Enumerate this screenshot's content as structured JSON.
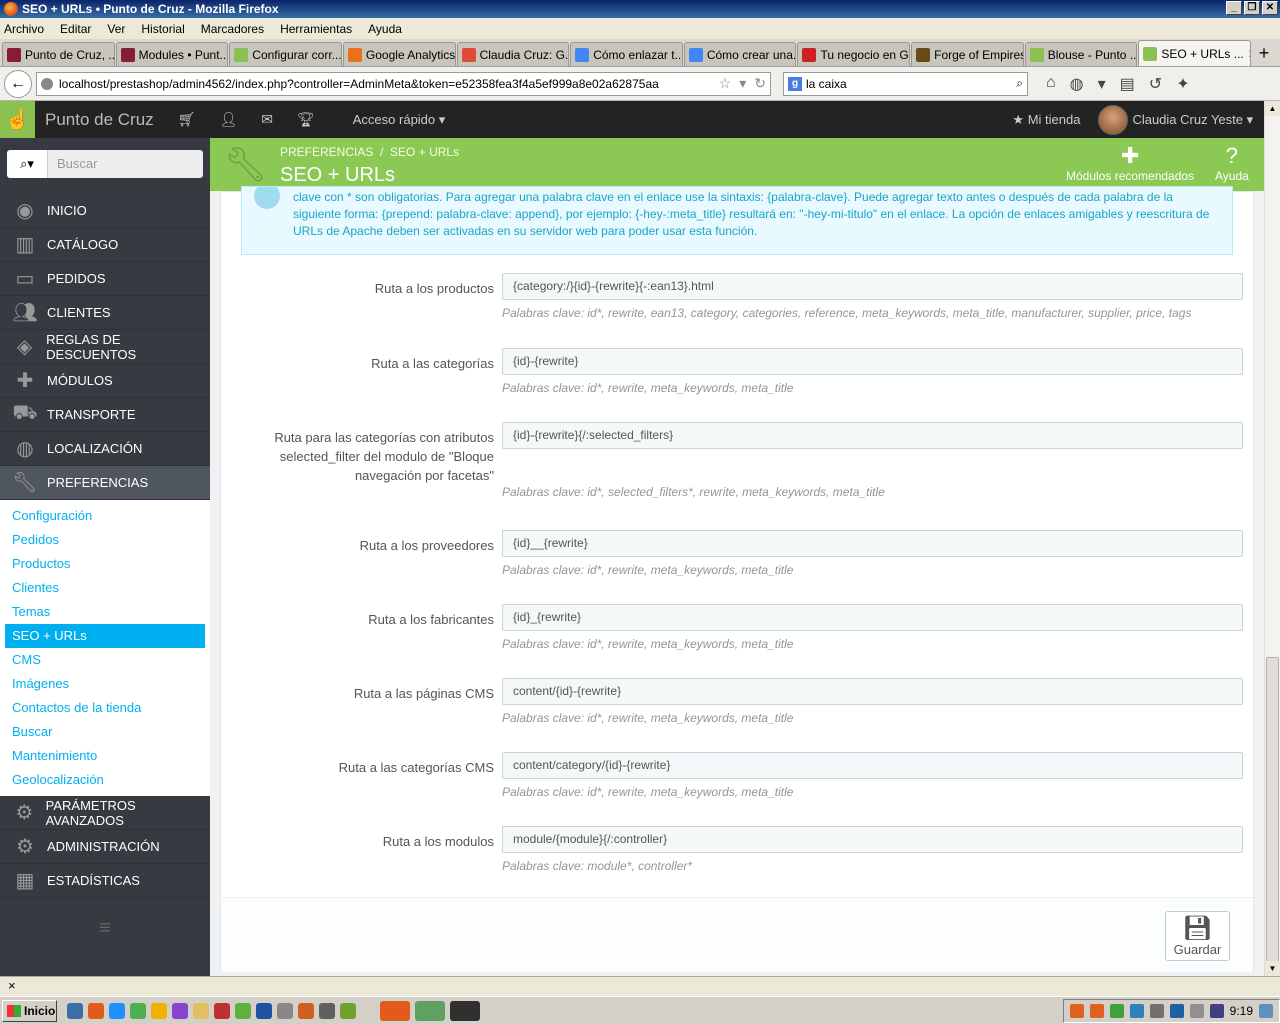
{
  "window": {
    "title": "SEO + URLs • Punto de Cruz - Mozilla Firefox"
  },
  "menubar": [
    "Archivo",
    "Editar",
    "Ver",
    "Historial",
    "Marcadores",
    "Herramientas",
    "Ayuda"
  ],
  "tabs": [
    {
      "label": "Punto de Cruz, ...",
      "color": "#8a1a3a",
      "active": false
    },
    {
      "label": "Modules • Punt...",
      "color": "#8a1a3a",
      "active": false
    },
    {
      "label": "Configurar corr...",
      "color": "#8cc152",
      "active": false
    },
    {
      "label": "Google Analytics",
      "color": "#e8711a",
      "active": false
    },
    {
      "label": "Claudia Cruz: G...",
      "color": "#dd4b39",
      "active": false
    },
    {
      "label": "Cómo enlazar t...",
      "color": "#4285f4",
      "active": false
    },
    {
      "label": "Cómo crear una...",
      "color": "#4285f4",
      "active": false
    },
    {
      "label": "Tu negocio en G...",
      "color": "#cc2222",
      "active": false
    },
    {
      "label": "Forge of Empires",
      "color": "#6b4a1a",
      "active": false
    },
    {
      "label": "Blouse - Punto ...",
      "color": "#8cc152",
      "active": false
    },
    {
      "label": "SEO + URLs ...",
      "color": "#8cc152",
      "active": true
    }
  ],
  "nav": {
    "url": "localhost/prestashop/admin4562/index.php?controller=AdminMeta&token=e52358fea3f4a5ef999a8e02a62875aa",
    "search_value": "la caixa"
  },
  "header": {
    "shop_name": "Punto de Cruz",
    "quick_access": "Acceso rápido",
    "my_shop": "Mi tienda",
    "user_name": "Claudia Cruz Yeste"
  },
  "sidebar": {
    "search_placeholder": "Buscar",
    "items_top": [
      {
        "label": "INICIO",
        "icon": "dashboard-icon"
      },
      {
        "label": "CATÁLOGO",
        "icon": "book-icon"
      },
      {
        "label": "PEDIDOS",
        "icon": "credit-card-icon"
      },
      {
        "label": "CLIENTES",
        "icon": "users-icon"
      },
      {
        "label": "REGLAS DE DESCUENTOS",
        "icon": "tags-icon"
      },
      {
        "label": "MÓDULOS",
        "icon": "puzzle-icon"
      },
      {
        "label": "TRANSPORTE",
        "icon": "truck-icon"
      },
      {
        "label": "LOCALIZACIÓN",
        "icon": "globe-icon"
      },
      {
        "label": "PREFERENCIAS",
        "icon": "wrench-icon"
      }
    ],
    "submenu": [
      {
        "label": "Configuración",
        "active": false
      },
      {
        "label": "Pedidos",
        "active": false
      },
      {
        "label": "Productos",
        "active": false
      },
      {
        "label": "Clientes",
        "active": false
      },
      {
        "label": "Temas",
        "active": false
      },
      {
        "label": "SEO + URLs",
        "active": true
      },
      {
        "label": "CMS",
        "active": false
      },
      {
        "label": "Imágenes",
        "active": false
      },
      {
        "label": "Contactos de la tienda",
        "active": false
      },
      {
        "label": "Buscar",
        "active": false
      },
      {
        "label": "Mantenimiento",
        "active": false
      },
      {
        "label": "Geolocalización",
        "active": false
      }
    ],
    "items_bottom": [
      {
        "label": "PARÁMETROS AVANZADOS",
        "icon": "cogs-icon"
      },
      {
        "label": "ADMINISTRACIÓN",
        "icon": "gear-icon"
      },
      {
        "label": "ESTADÍSTICAS",
        "icon": "bar-chart-icon"
      }
    ]
  },
  "page": {
    "breadcrumb_parent": "PREFERENCIAS",
    "breadcrumb_sep": "/",
    "breadcrumb_current": "SEO + URLs",
    "title": "SEO + URLs",
    "btn_modules": "Módulos recomendados",
    "btn_help": "Ayuda"
  },
  "alert": {
    "text": "clave con * son obligatorias. Para agregar una palabra clave en el enlace use la sintaxis: {palabra-clave}. Puede agregar texto antes o después de cada palabra de la siguiente forma: {prepend: palabra-clave: append}, por ejemplo: {-hey-:meta_title} resultará en: \"-hey-mi-titulo\" en el enlace. La opción de enlaces amigables y reescritura de URLs de Apache deben ser activadas en su servidor web para poder usar esta función."
  },
  "routes": [
    {
      "label": "Ruta a los productos",
      "value": "{category:/}{id}-{rewrite}{-:ean13}.html",
      "help": "Palabras clave: id*, rewrite, ean13, category, categories, reference, meta_keywords, meta_title, manufacturer, supplier, price, tags"
    },
    {
      "label": "Ruta a las categorías",
      "value": "{id}-{rewrite}",
      "help": "Palabras clave: id*, rewrite, meta_keywords, meta_title"
    },
    {
      "label": "Ruta para las categorías con atributos selected_filter del modulo de \"Bloque navegación por facetas\"",
      "value": "{id}-{rewrite}{/:selected_filters}",
      "help": "Palabras clave: id*, selected_filters*, rewrite, meta_keywords, meta_title"
    },
    {
      "label": "Ruta a los proveedores",
      "value": "{id}__{rewrite}",
      "help": "Palabras clave: id*, rewrite, meta_keywords, meta_title"
    },
    {
      "label": "Ruta a los fabricantes",
      "value": "{id}_{rewrite}",
      "help": "Palabras clave: id*, rewrite, meta_keywords, meta_title"
    },
    {
      "label": "Ruta a las páginas CMS",
      "value": "content/{id}-{rewrite}",
      "help": "Palabras clave: id*, rewrite, meta_keywords, meta_title"
    },
    {
      "label": "Ruta a las categorías CMS",
      "value": "content/category/{id}-{rewrite}",
      "help": "Palabras clave: id*, rewrite, meta_keywords, meta_title"
    },
    {
      "label": "Ruta a los modulos",
      "value": "module/{module}{/:controller}",
      "help": "Palabras clave: module*, controller*"
    }
  ],
  "save_label": "Guardar",
  "statusbar": {
    "close_glyph": "×"
  },
  "taskbar": {
    "start_label": "Inicio",
    "clock": "9:19"
  },
  "colors": {
    "accent_green": "#8bc954",
    "sidebar_bg": "#363a41",
    "link_blue": "#00aff0",
    "header_bg": "#232323"
  }
}
